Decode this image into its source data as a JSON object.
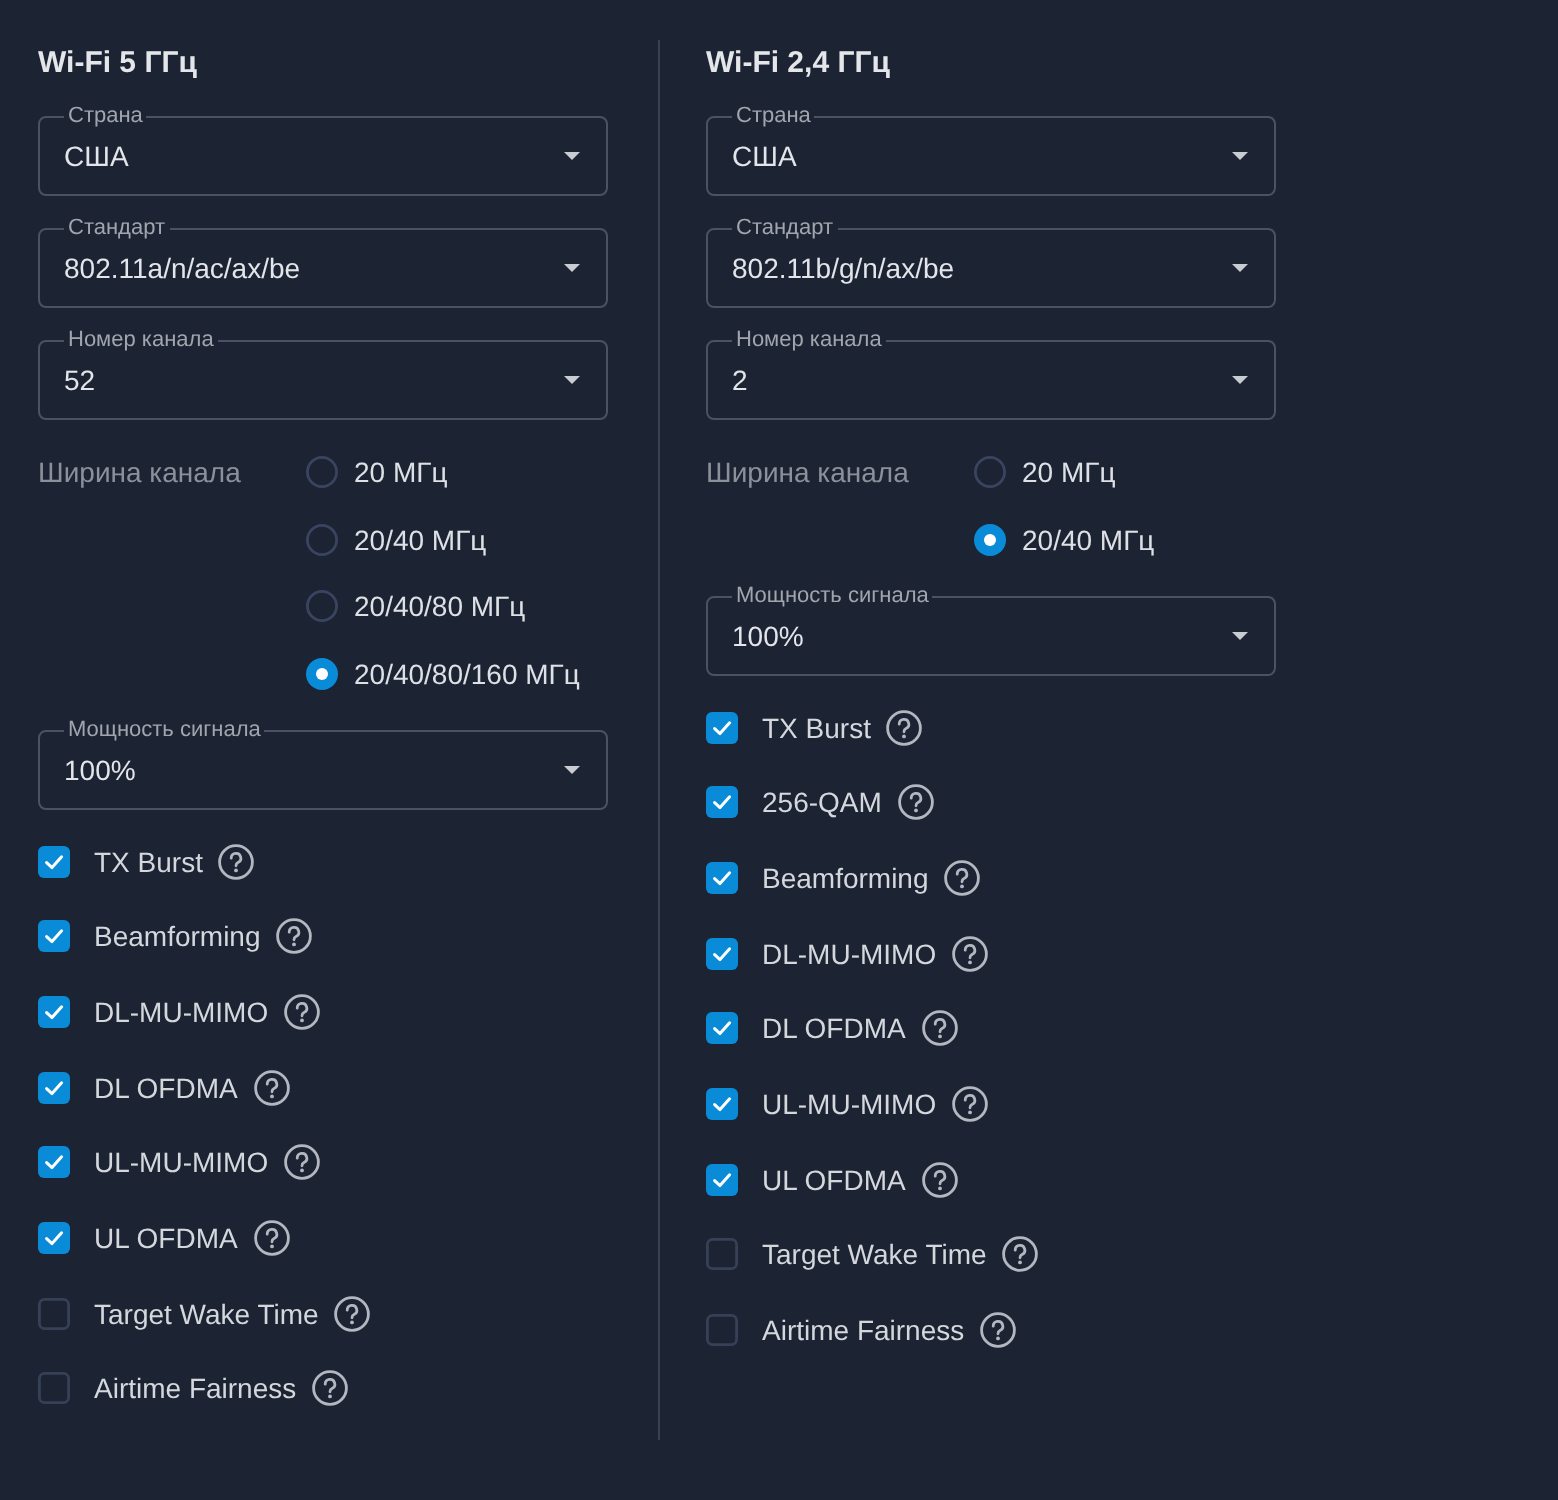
{
  "bands": [
    {
      "title": "Wi-Fi 5 ГГц",
      "selects": [
        {
          "label": "Страна",
          "value": "США"
        },
        {
          "label": "Стандарт",
          "value": "802.11a/n/ac/ax/be"
        },
        {
          "label": "Номер канала",
          "value": "52"
        }
      ],
      "channel_width": {
        "label": "Ширина канала",
        "options": [
          {
            "label": "20 МГц",
            "selected": false
          },
          {
            "label": "20/40 МГц",
            "selected": false
          },
          {
            "label": "20/40/80 МГц",
            "selected": false
          },
          {
            "label": "20/40/80/160 МГц",
            "selected": true
          }
        ]
      },
      "power": {
        "label": "Мощность сигнала",
        "value": "100%"
      },
      "features": [
        {
          "label": "TX Burst",
          "checked": true
        },
        {
          "label": "Beamforming",
          "checked": true
        },
        {
          "label": "DL-MU-MIMO",
          "checked": true
        },
        {
          "label": "DL OFDMA",
          "checked": true
        },
        {
          "label": "UL-MU-MIMO",
          "checked": true
        },
        {
          "label": "UL OFDMA",
          "checked": true
        },
        {
          "label": "Target Wake Time",
          "checked": false
        },
        {
          "label": "Airtime Fairness",
          "checked": false
        }
      ]
    },
    {
      "title": "Wi-Fi 2,4 ГГц",
      "selects": [
        {
          "label": "Страна",
          "value": "США"
        },
        {
          "label": "Стандарт",
          "value": "802.11b/g/n/ax/be"
        },
        {
          "label": "Номер канала",
          "value": "2"
        }
      ],
      "channel_width": {
        "label": "Ширина канала",
        "options": [
          {
            "label": "20 МГц",
            "selected": false
          },
          {
            "label": "20/40 МГц",
            "selected": true
          }
        ]
      },
      "power": {
        "label": "Мощность сигнала",
        "value": "100%"
      },
      "features": [
        {
          "label": "TX Burst",
          "checked": true
        },
        {
          "label": "256-QAM",
          "checked": true
        },
        {
          "label": "Beamforming",
          "checked": true
        },
        {
          "label": "DL-MU-MIMO",
          "checked": true
        },
        {
          "label": "DL OFDMA",
          "checked": true
        },
        {
          "label": "UL-MU-MIMO",
          "checked": true
        },
        {
          "label": "UL OFDMA",
          "checked": true
        },
        {
          "label": "Target Wake Time",
          "checked": false
        },
        {
          "label": "Airtime Fairness",
          "checked": false
        }
      ]
    }
  ]
}
